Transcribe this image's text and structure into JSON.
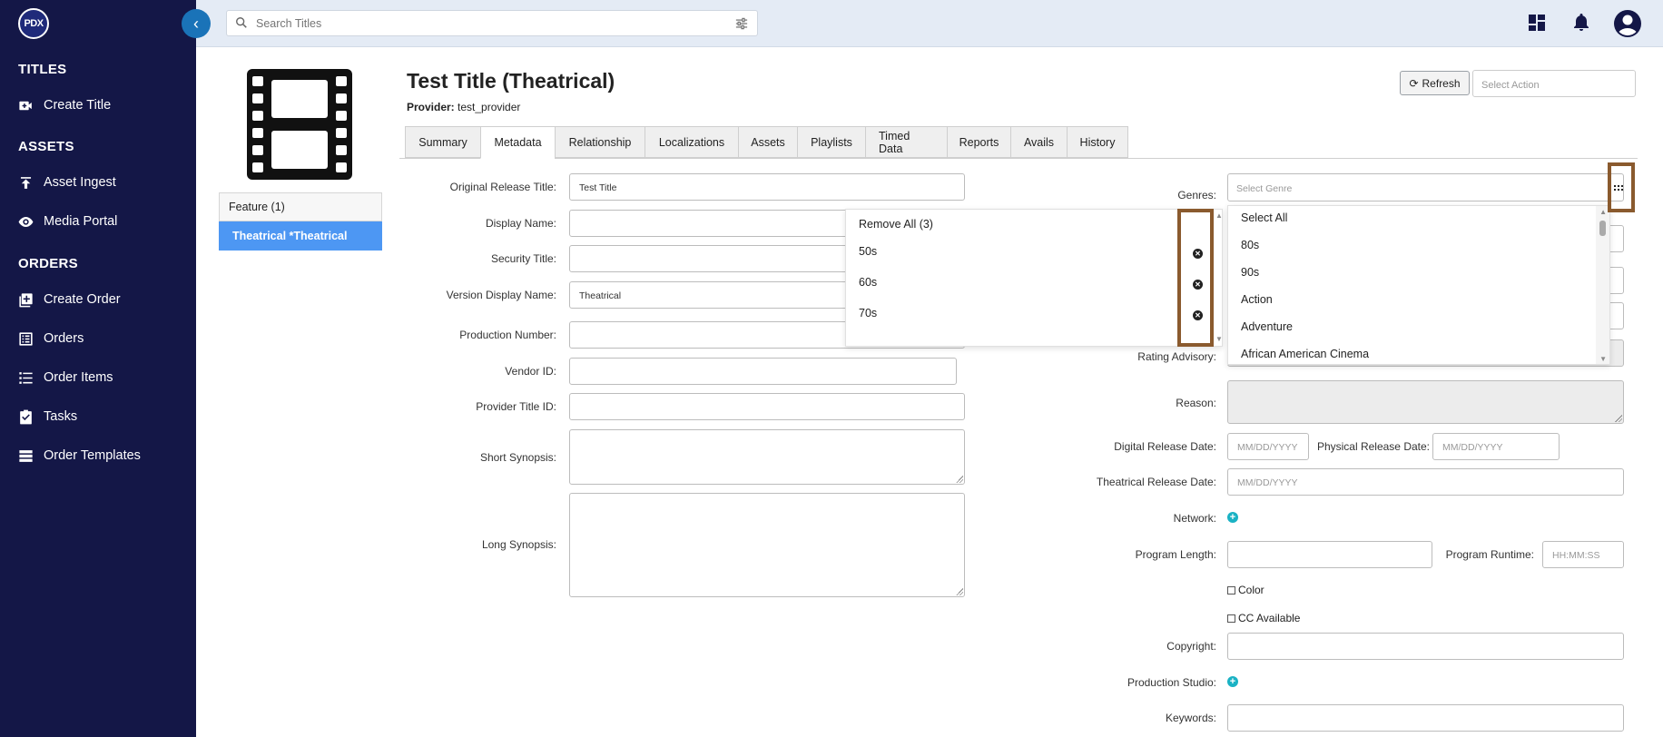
{
  "sidebar": {
    "logo": "PDX",
    "sections": [
      {
        "heading": "TITLES",
        "items": [
          {
            "label": "Create Title",
            "icon": "video-plus-icon"
          }
        ]
      },
      {
        "heading": "ASSETS",
        "items": [
          {
            "label": "Asset Ingest",
            "icon": "upload-icon"
          },
          {
            "label": "Media Portal",
            "icon": "eye-icon"
          }
        ]
      },
      {
        "heading": "ORDERS",
        "items": [
          {
            "label": "Create Order",
            "icon": "add-box-icon"
          },
          {
            "label": "Orders",
            "icon": "list-box-icon"
          },
          {
            "label": "Order Items",
            "icon": "list-icon"
          },
          {
            "label": "Tasks",
            "icon": "clipboard-check-icon"
          },
          {
            "label": "Order Templates",
            "icon": "table-icon"
          }
        ]
      }
    ]
  },
  "topbar": {
    "search_placeholder": "Search Titles",
    "icons": [
      "dashboard-icon",
      "bell-icon",
      "account-icon"
    ]
  },
  "header": {
    "title": "Test Title (Theatrical)",
    "provider_label": "Provider:",
    "provider_value": "test_provider",
    "refresh_label": "Refresh",
    "action_placeholder": "Select Action"
  },
  "versions": [
    "Feature (1)",
    "Theatrical *Theatrical"
  ],
  "tabs": [
    "Summary",
    "Metadata",
    "Relationship",
    "Localizations",
    "Assets",
    "Playlists",
    "Timed Data",
    "Reports",
    "Avails",
    "History"
  ],
  "active_tab": "Metadata",
  "form_left": {
    "original_release_title": {
      "label": "Original Release Title:",
      "value": "Test Title"
    },
    "display_name": {
      "label": "Display Name:",
      "value": ""
    },
    "security_title": {
      "label": "Security Title:",
      "value": ""
    },
    "version_display_name": {
      "label": "Version Display Name:",
      "value": "Theatrical"
    },
    "production_number": {
      "label": "Production Number:",
      "value": ""
    },
    "vendor_id": {
      "label": "Vendor ID:",
      "value": ""
    },
    "provider_title_id": {
      "label": "Provider Title ID:",
      "value": ""
    },
    "short_synopsis": {
      "label": "Short Synopsis:"
    },
    "long_synopsis": {
      "label": "Long Synopsis:"
    }
  },
  "selected_genres": {
    "remove_all": "Remove All (3)",
    "items": [
      "50s",
      "60s",
      "70s"
    ]
  },
  "genres": {
    "label": "Genres:",
    "placeholder": "Select Genre",
    "options": [
      "Select All",
      "80s",
      "90s",
      "Action",
      "Adventure",
      "African American Cinema"
    ]
  },
  "form_right": {
    "rating_advisory": {
      "label": "Rating Advisory:"
    },
    "reason": {
      "label": "Reason:"
    },
    "digital_release_date": {
      "label": "Digital Release Date:",
      "placeholder": "MM/DD/YYYY"
    },
    "physical_release_date": {
      "label": "Physical Release Date:",
      "placeholder": "MM/DD/YYYY"
    },
    "theatrical_release_date": {
      "label": "Theatrical Release Date:",
      "placeholder": "MM/DD/YYYY"
    },
    "network": {
      "label": "Network:"
    },
    "program_length": {
      "label": "Program Length:"
    },
    "program_runtime": {
      "label": "Program Runtime:",
      "placeholder": "HH:MM:SS"
    },
    "color": {
      "label": "Color"
    },
    "cc_available": {
      "label": "CC Available"
    },
    "copyright": {
      "label": "Copyright:"
    },
    "production_studio": {
      "label": "Production Studio:"
    },
    "keywords": {
      "label": "Keywords:"
    }
  },
  "colors": {
    "sidebar_bg": "#141747",
    "active_version": "#4d97f3",
    "highlight": "#8a5a2e",
    "plus_icon": "#1ab2c4"
  }
}
